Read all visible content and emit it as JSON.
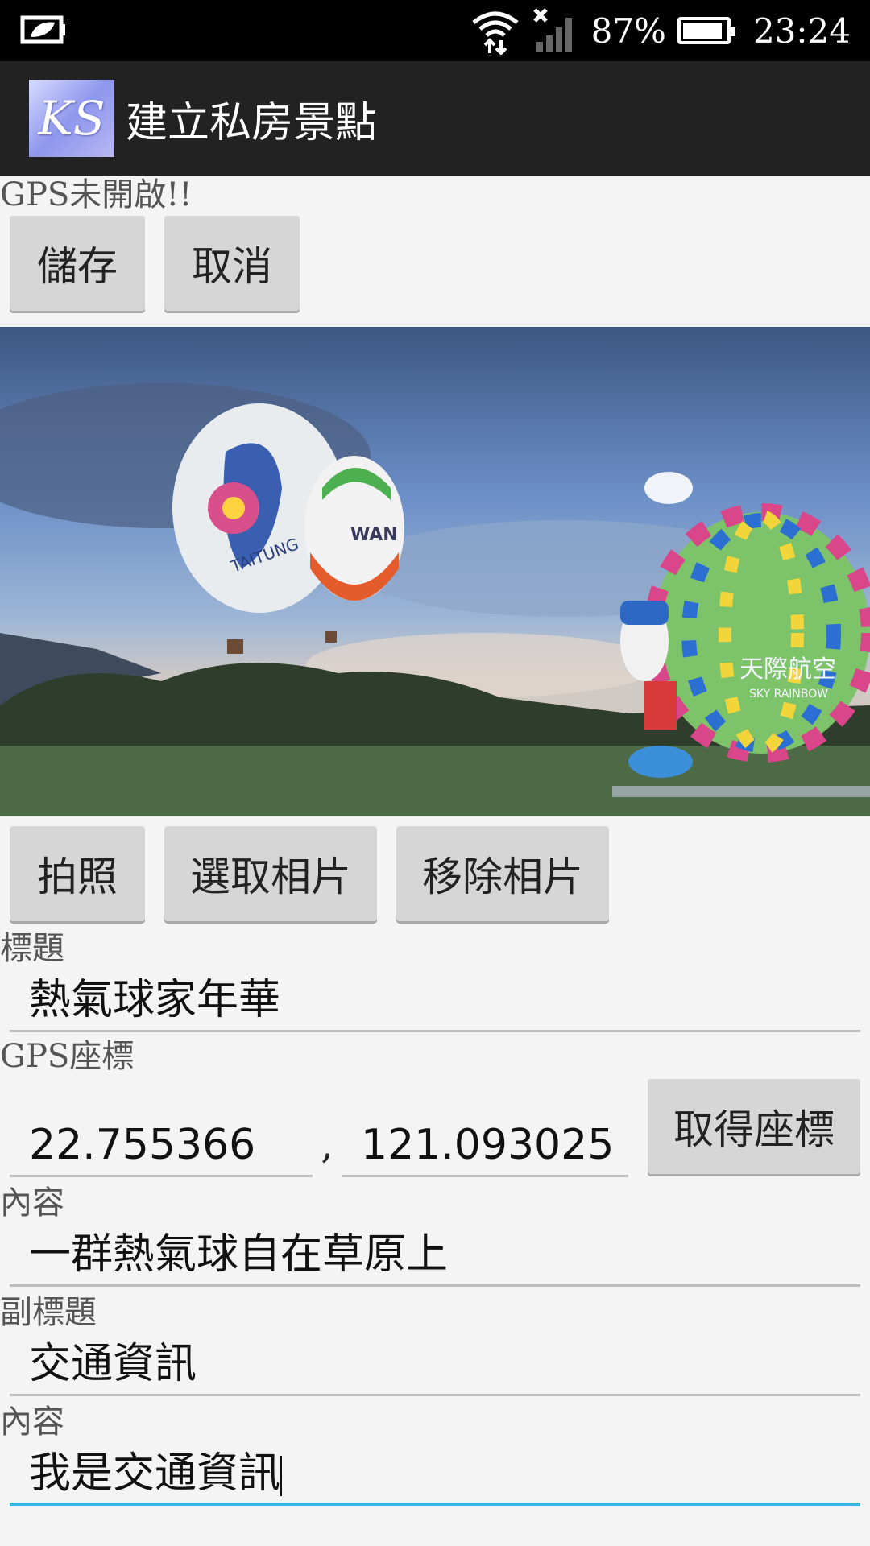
{
  "status_bar": {
    "battery_percent": "87%",
    "time": "23:24",
    "icons": [
      "battery-saver-icon",
      "wifi-icon",
      "signal-icon",
      "battery-icon"
    ]
  },
  "action_bar": {
    "logo_text": "KS",
    "title": "建立私房景點"
  },
  "gps_status": "GPS未開啟!!",
  "top_buttons": {
    "save": "儲存",
    "cancel": "取消"
  },
  "photo_buttons": {
    "take": "拍照",
    "select": "選取相片",
    "remove": "移除相片"
  },
  "form": {
    "title_label": "標題",
    "title_value": "熱氣球家年華",
    "gps_label": "GPS座標",
    "lat_value": "22.755366",
    "separator": ",",
    "lng_value": "121.093025",
    "get_coords_button": "取得座標",
    "content_label": "內容",
    "content_value": "一群熱氣球自在草原上",
    "subtitle_label": "副標題",
    "subtitle_value": "交通資訊",
    "content2_label": "內容",
    "content2_value": "我是交通資訊"
  },
  "photo_balloon_texts": {
    "left_balloon": "TAITUNG",
    "middle_balloon": "WAN",
    "right_balloon": "天際航空",
    "right_balloon_sub": "SKY RAINBOW"
  },
  "colors": {
    "status_bar_bg": "#000000",
    "action_bar_bg": "#222222",
    "button_bg": "#d6d6d6",
    "active_underline": "#33b5e5"
  }
}
